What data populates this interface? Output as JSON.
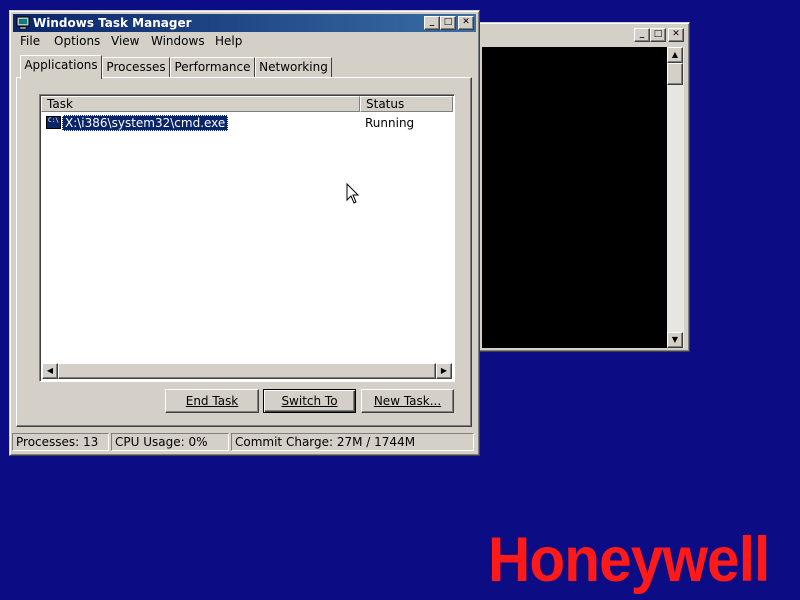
{
  "desktop": {
    "background_color": "#0c0c84",
    "brand_logo": "Honeywell",
    "brand_color": "#ff1a1a"
  },
  "cmd_window": {
    "title": "",
    "background": "#000000"
  },
  "task_manager": {
    "title": "Windows Task Manager",
    "title_icon": "task-manager-icon",
    "menu": [
      "File",
      "Options",
      "View",
      "Windows",
      "Help"
    ],
    "tabs": [
      {
        "label": "Applications",
        "active": true
      },
      {
        "label": "Processes",
        "active": false
      },
      {
        "label": "Performance",
        "active": false
      },
      {
        "label": "Networking",
        "active": false
      }
    ],
    "columns": {
      "task": "Task",
      "status": "Status"
    },
    "tasks": [
      {
        "name": "X:\\i386\\system32\\cmd.exe",
        "status": "Running",
        "icon": "cmd-icon",
        "selected": true
      }
    ],
    "buttons": {
      "end_task": "End Task",
      "switch_to": "Switch To",
      "new_task": "New Task..."
    },
    "status_bar": {
      "processes": "Processes: 13",
      "cpu": "CPU Usage: 0%",
      "commit": "Commit Charge: 27M / 1744M"
    }
  }
}
